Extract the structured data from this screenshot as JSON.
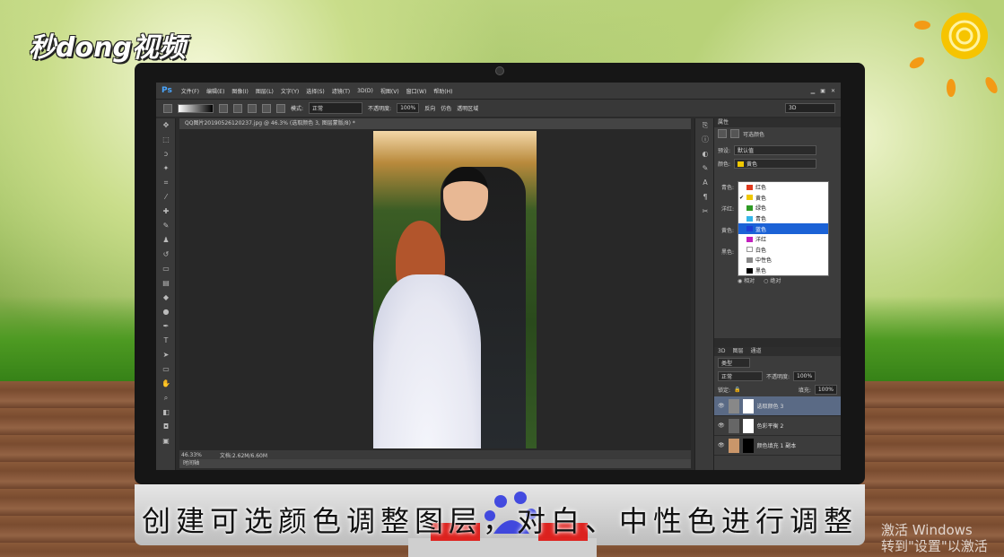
{
  "brand": {
    "logo": "秒dong视频"
  },
  "caption": "创建可选颜色调整图层，对白、中性色进行调整",
  "watermark": {
    "line1": "激活 Windows",
    "line2": "转到\"设置\"以激活 W"
  },
  "ps": {
    "app": "Ps",
    "menu": [
      "文件(F)",
      "编辑(E)",
      "图像(I)",
      "图层(L)",
      "文字(Y)",
      "选择(S)",
      "滤镜(T)",
      "3D(D)",
      "视图(V)",
      "窗口(W)",
      "帮助(H)"
    ],
    "options": {
      "mode_label": "模式:",
      "mode_value": "正常",
      "opacity_label": "不透明度:",
      "opacity_value": "100%",
      "reverse": "反向",
      "dither": "仿色",
      "transparency": "透明区域",
      "workspace": "3D"
    },
    "doc_tab": "QQ图片20190526120237.jpg @ 46.3% (选取颜色 3, 图层蒙版/8) *",
    "status": {
      "zoom": "46.33%",
      "doc": "文档:2.62M/6.60M"
    },
    "timeline": "时间轴",
    "properties": {
      "tab": "属性",
      "title": "可选颜色",
      "preset_label": "预设:",
      "preset_value": "默认值",
      "color_label": "颜色:",
      "color_value": "黄色",
      "slider_labels": [
        "青色:",
        "洋红:",
        "黄色:",
        "黑色:"
      ],
      "radio": [
        "相对",
        "绝对"
      ]
    },
    "dropdown": [
      {
        "label": "红色",
        "color": "#e03a1e",
        "checked": false,
        "active": false
      },
      {
        "label": "黄色",
        "color": "#f0c800",
        "checked": true,
        "active": false
      },
      {
        "label": "绿色",
        "color": "#2e9a24",
        "checked": false,
        "active": false
      },
      {
        "label": "青色",
        "color": "#35b6e8",
        "checked": false,
        "active": false
      },
      {
        "label": "蓝色",
        "color": "#1f3fd6",
        "checked": false,
        "active": true
      },
      {
        "label": "洋红",
        "color": "#c21fbe",
        "checked": false,
        "active": false
      },
      {
        "label": "白色",
        "color": "#ffffff",
        "checked": false,
        "active": false
      },
      {
        "label": "中性色",
        "color": "#888888",
        "checked": false,
        "active": false
      },
      {
        "label": "黑色",
        "color": "#000000",
        "checked": false,
        "active": false
      }
    ],
    "layers": {
      "tabs": [
        "3D",
        "图层",
        "通道"
      ],
      "kind": "类型",
      "blend": "正常",
      "opacity_label": "不透明度:",
      "opacity_value": "100%",
      "lock_label": "锁定:",
      "fill_label": "填充:",
      "fill_value": "100%",
      "items": [
        "选取颜色 3",
        "色彩平衡 2",
        "颜色填充 1 副本"
      ]
    }
  }
}
